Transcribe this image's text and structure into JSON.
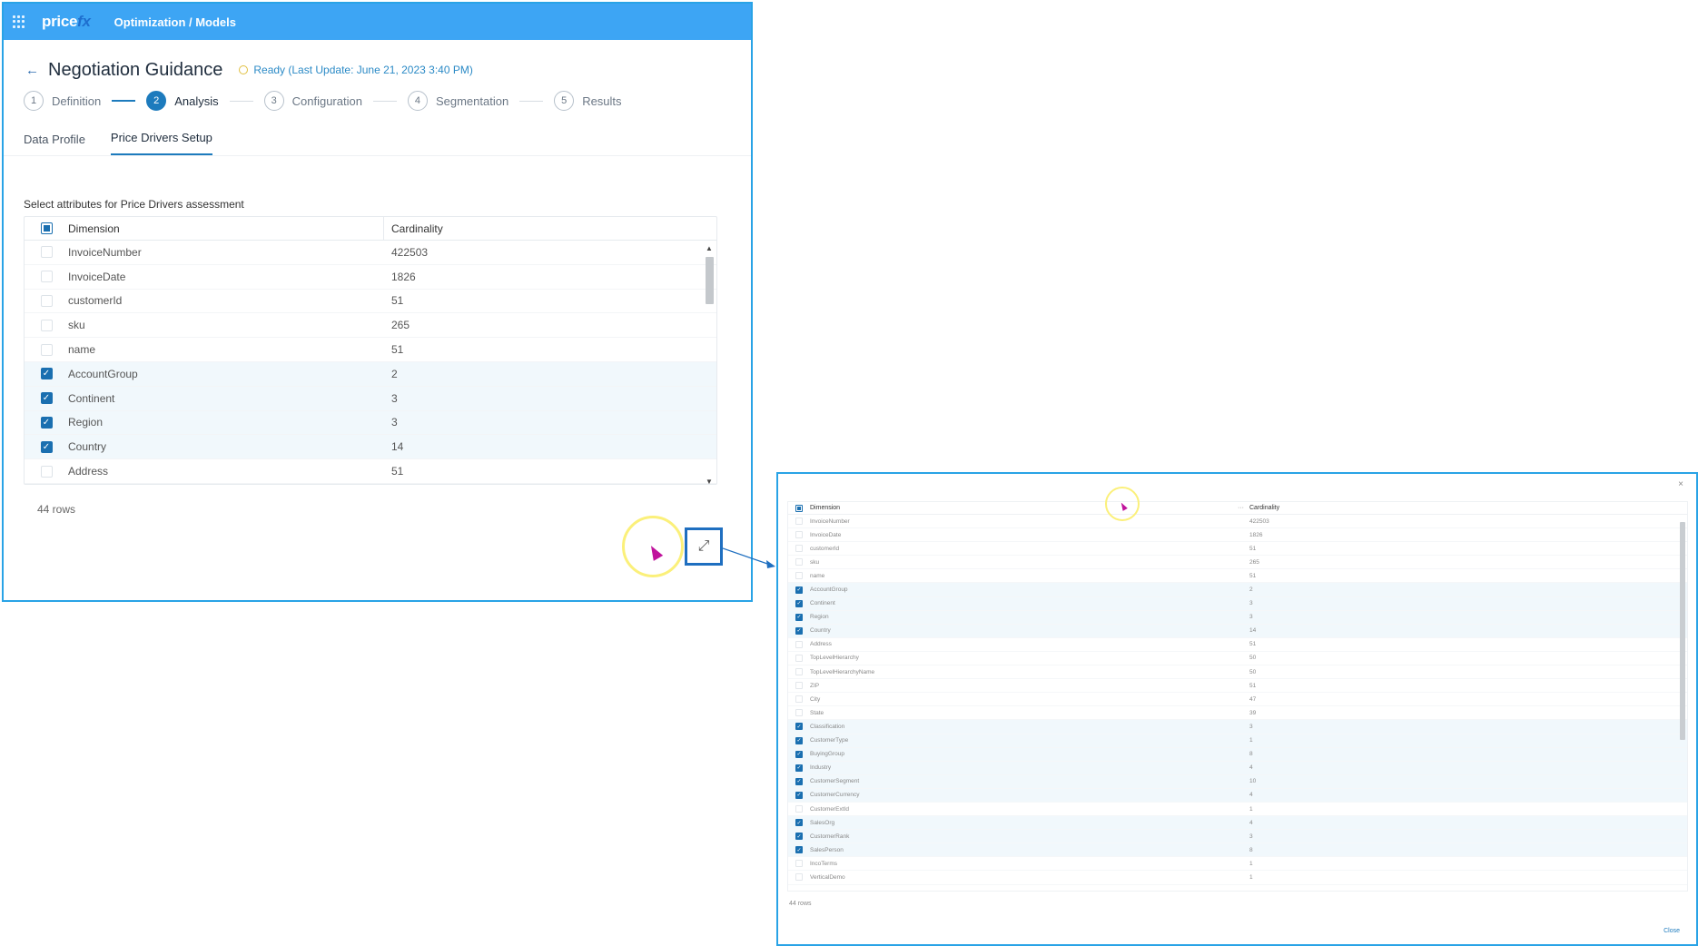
{
  "topbar": {
    "logo_main": "price",
    "logo_accent": "fx",
    "breadcrumb": "Optimization / Models"
  },
  "header": {
    "back_icon": "arrow-left-icon",
    "title": "Negotiation Guidance",
    "status": "Ready (Last Update: June 21, 2023 3:40 PM)"
  },
  "stepper": [
    {
      "num": "1",
      "label": "Definition",
      "active": false
    },
    {
      "num": "2",
      "label": "Analysis",
      "active": true
    },
    {
      "num": "3",
      "label": "Configuration",
      "active": false
    },
    {
      "num": "4",
      "label": "Segmentation",
      "active": false
    },
    {
      "num": "5",
      "label": "Results",
      "active": false
    }
  ],
  "tabs": [
    {
      "label": "Data Profile",
      "active": false
    },
    {
      "label": "Price Drivers Setup",
      "active": true
    }
  ],
  "section_label": "Select attributes for Price Drivers assessment",
  "table": {
    "col_dimension": "Dimension",
    "col_cardinality": "Cardinality",
    "rows": [
      {
        "dimension": "InvoiceNumber",
        "cardinality": "422503",
        "checked": false
      },
      {
        "dimension": "InvoiceDate",
        "cardinality": "1826",
        "checked": false
      },
      {
        "dimension": "customerId",
        "cardinality": "51",
        "checked": false
      },
      {
        "dimension": "sku",
        "cardinality": "265",
        "checked": false
      },
      {
        "dimension": "name",
        "cardinality": "51",
        "checked": false
      },
      {
        "dimension": "AccountGroup",
        "cardinality": "2",
        "checked": true
      },
      {
        "dimension": "Continent",
        "cardinality": "3",
        "checked": true
      },
      {
        "dimension": "Region",
        "cardinality": "3",
        "checked": true
      },
      {
        "dimension": "Country",
        "cardinality": "14",
        "checked": true
      },
      {
        "dimension": "Address",
        "cardinality": "51",
        "checked": false
      }
    ],
    "row_count": "44 rows"
  },
  "expand_icon": "expand-icon",
  "modal": {
    "close_x": "×",
    "col_dimension": "Dimension",
    "col_menu": "···",
    "col_cardinality": "Cardinality",
    "rows": [
      {
        "dimension": "InvoiceNumber",
        "cardinality": "422503",
        "checked": false
      },
      {
        "dimension": "InvoiceDate",
        "cardinality": "1826",
        "checked": false
      },
      {
        "dimension": "customerId",
        "cardinality": "51",
        "checked": false
      },
      {
        "dimension": "sku",
        "cardinality": "265",
        "checked": false
      },
      {
        "dimension": "name",
        "cardinality": "51",
        "checked": false
      },
      {
        "dimension": "AccountGroup",
        "cardinality": "2",
        "checked": true
      },
      {
        "dimension": "Continent",
        "cardinality": "3",
        "checked": true
      },
      {
        "dimension": "Region",
        "cardinality": "3",
        "checked": true
      },
      {
        "dimension": "Country",
        "cardinality": "14",
        "checked": true
      },
      {
        "dimension": "Address",
        "cardinality": "51",
        "checked": false
      },
      {
        "dimension": "TopLevelHierarchy",
        "cardinality": "50",
        "checked": false
      },
      {
        "dimension": "TopLevelHierarchyName",
        "cardinality": "50",
        "checked": false
      },
      {
        "dimension": "ZIP",
        "cardinality": "51",
        "checked": false
      },
      {
        "dimension": "City",
        "cardinality": "47",
        "checked": false
      },
      {
        "dimension": "State",
        "cardinality": "39",
        "checked": false
      },
      {
        "dimension": "Classification",
        "cardinality": "3",
        "checked": true
      },
      {
        "dimension": "CustomerType",
        "cardinality": "1",
        "checked": true
      },
      {
        "dimension": "BuyingGroup",
        "cardinality": "8",
        "checked": true
      },
      {
        "dimension": "Industry",
        "cardinality": "4",
        "checked": true
      },
      {
        "dimension": "CustomerSegment",
        "cardinality": "10",
        "checked": true
      },
      {
        "dimension": "CustomerCurrency",
        "cardinality": "4",
        "checked": true
      },
      {
        "dimension": "CustomerExtId",
        "cardinality": "1",
        "checked": false
      },
      {
        "dimension": "SalesOrg",
        "cardinality": "4",
        "checked": true
      },
      {
        "dimension": "CustomerRank",
        "cardinality": "3",
        "checked": true
      },
      {
        "dimension": "SalesPerson",
        "cardinality": "8",
        "checked": true
      },
      {
        "dimension": "IncoTerms",
        "cardinality": "1",
        "checked": false
      },
      {
        "dimension": "VerticalDemo",
        "cardinality": "1",
        "checked": false
      }
    ],
    "row_count": "44 rows",
    "close_label": "Close"
  },
  "colors": {
    "topbar": "#3da5f4",
    "accent": "#1d7bbd",
    "frame": "#29a3e6",
    "highlight_ring": "#fbf07a",
    "cursor": "#c0139c"
  }
}
